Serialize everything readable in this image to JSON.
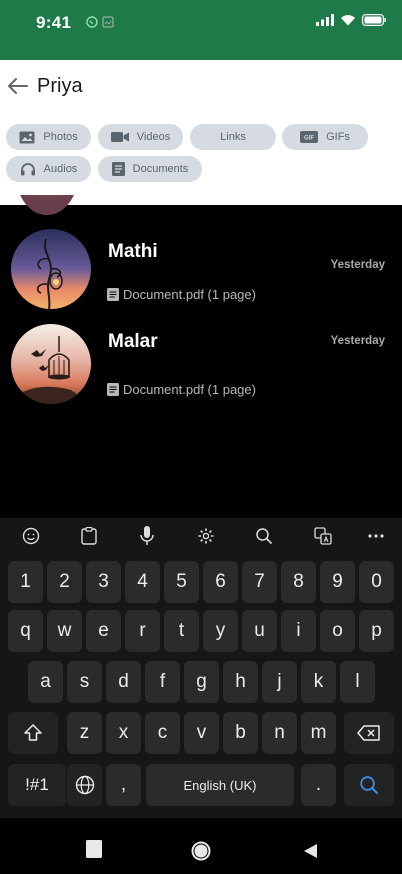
{
  "status_bar": {
    "time": "9:41"
  },
  "header": {
    "title": "Priya"
  },
  "chips": [
    {
      "label": "Photos",
      "icon": "photo-icon"
    },
    {
      "label": "Videos",
      "icon": "video-icon"
    },
    {
      "label": "Links",
      "icon": ""
    },
    {
      "label": "GIFs",
      "icon": "gif-icon"
    },
    {
      "label": "Audios",
      "icon": "headphones-icon"
    },
    {
      "label": "Documents",
      "icon": "document-icon"
    }
  ],
  "results": [
    {
      "name": "Mathi",
      "date": "Yesterday",
      "document": "Document.pdf (1 page)"
    },
    {
      "name": "Malar",
      "date": "Yesterday",
      "document": "Document.pdf (1 page)"
    }
  ],
  "keyboard": {
    "toolbar": [
      "emoji-icon",
      "clipboard-icon",
      "microphone-icon",
      "settings-icon",
      "search-icon",
      "translate-icon",
      "more-icon"
    ],
    "row_numbers": [
      "1",
      "2",
      "3",
      "4",
      "5",
      "6",
      "7",
      "8",
      "9",
      "0"
    ],
    "row1": [
      "q",
      "w",
      "e",
      "r",
      "t",
      "y",
      "u",
      "i",
      "o",
      "p"
    ],
    "row2": [
      "a",
      "s",
      "d",
      "f",
      "g",
      "h",
      "j",
      "k",
      "l"
    ],
    "row3": [
      "z",
      "x",
      "c",
      "v",
      "b",
      "n",
      "m"
    ],
    "symbols_label": "!#1",
    "comma": ",",
    "space_label": "English (UK)",
    "period": "."
  },
  "colors": {
    "accent": "#1f7a4a",
    "chip_bg": "#d5dbe1",
    "keyboard_bg": "#161616",
    "search_key": "#3b8fe0"
  }
}
